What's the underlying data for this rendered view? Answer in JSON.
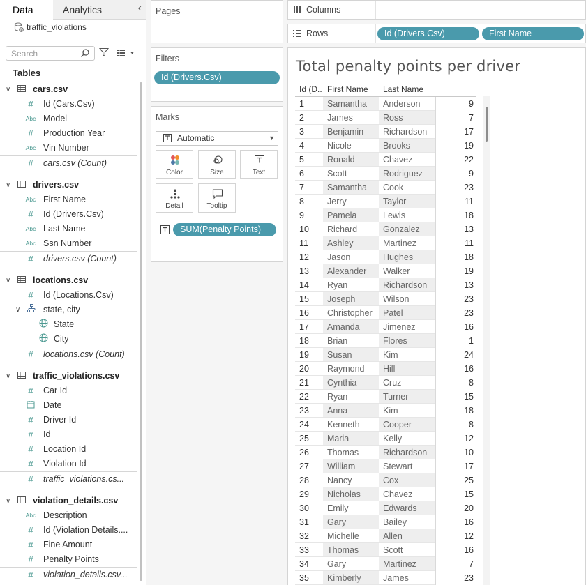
{
  "pane_tabs": {
    "data": "Data",
    "analytics": "Analytics"
  },
  "datasource": "traffic_violations",
  "search": {
    "placeholder": "Search",
    "value": ""
  },
  "tables_heading": "Tables",
  "tables": [
    {
      "name": "cars.csv",
      "fields": [
        {
          "type": "number",
          "label": "Id (Cars.Csv)"
        },
        {
          "type": "string",
          "label": "Model"
        },
        {
          "type": "number",
          "label": "Production Year"
        },
        {
          "type": "string",
          "label": "Vin Number"
        },
        {
          "type": "count",
          "label": "cars.csv (Count)"
        }
      ]
    },
    {
      "name": "drivers.csv",
      "fields": [
        {
          "type": "string",
          "label": "First Name"
        },
        {
          "type": "number",
          "label": "Id (Drivers.Csv)"
        },
        {
          "type": "string",
          "label": "Last Name"
        },
        {
          "type": "string",
          "label": "Ssn Number"
        },
        {
          "type": "count",
          "label": "drivers.csv (Count)"
        }
      ]
    },
    {
      "name": "locations.csv",
      "fields": [
        {
          "type": "number",
          "label": "Id (Locations.Csv)"
        },
        {
          "type": "hierarchy",
          "label": "state, city"
        },
        {
          "type": "geo",
          "label": "State"
        },
        {
          "type": "geo",
          "label": "City"
        },
        {
          "type": "count",
          "label": "locations.csv (Count)"
        }
      ]
    },
    {
      "name": "traffic_violations.csv",
      "fields": [
        {
          "type": "number",
          "label": "Car Id"
        },
        {
          "type": "date",
          "label": "Date"
        },
        {
          "type": "number",
          "label": "Driver Id"
        },
        {
          "type": "number",
          "label": "Id"
        },
        {
          "type": "number",
          "label": "Location Id"
        },
        {
          "type": "number",
          "label": "Violation Id"
        },
        {
          "type": "count",
          "label": "traffic_violations.cs..."
        }
      ]
    },
    {
      "name": "violation_details.csv",
      "fields": [
        {
          "type": "string",
          "label": "Description"
        },
        {
          "type": "number",
          "label": "Id (Violation Details...."
        },
        {
          "type": "number",
          "label": "Fine Amount"
        },
        {
          "type": "number",
          "label": "Penalty Points"
        },
        {
          "type": "count",
          "label": "violation_details.csv..."
        }
      ]
    }
  ],
  "cards": {
    "pages": "Pages",
    "filters": "Filters",
    "marks": "Marks"
  },
  "filter_pill": "Id (Drivers.Csv)",
  "marks": {
    "type": "Automatic",
    "buttons": {
      "color": "Color",
      "size": "Size",
      "text": "Text",
      "detail": "Detail",
      "tooltip": "Tooltip"
    },
    "pill": "SUM(Penalty Points)"
  },
  "shelves": {
    "columns": "Columns",
    "rows": "Rows",
    "rows_pills": [
      "Id (Drivers.Csv)",
      "First Name"
    ]
  },
  "view": {
    "title": "Total penalty points per driver",
    "headers": {
      "id": "Id (D..",
      "first": "First Name",
      "last": "Last Name"
    },
    "rows": [
      [
        "1",
        "Samantha",
        "Anderson",
        "9"
      ],
      [
        "2",
        "James",
        "Ross",
        "7"
      ],
      [
        "3",
        "Benjamin",
        "Richardson",
        "17"
      ],
      [
        "4",
        "Nicole",
        "Brooks",
        "19"
      ],
      [
        "5",
        "Ronald",
        "Chavez",
        "22"
      ],
      [
        "6",
        "Scott",
        "Rodriguez",
        "9"
      ],
      [
        "7",
        "Samantha",
        "Cook",
        "23"
      ],
      [
        "8",
        "Jerry",
        "Taylor",
        "11"
      ],
      [
        "9",
        "Pamela",
        "Lewis",
        "18"
      ],
      [
        "10",
        "Richard",
        "Gonzalez",
        "13"
      ],
      [
        "11",
        "Ashley",
        "Martinez",
        "11"
      ],
      [
        "12",
        "Jason",
        "Hughes",
        "18"
      ],
      [
        "13",
        "Alexander",
        "Walker",
        "19"
      ],
      [
        "14",
        "Ryan",
        "Richardson",
        "13"
      ],
      [
        "15",
        "Joseph",
        "Wilson",
        "23"
      ],
      [
        "16",
        "Christopher",
        "Patel",
        "23"
      ],
      [
        "17",
        "Amanda",
        "Jimenez",
        "16"
      ],
      [
        "18",
        "Brian",
        "Flores",
        "1"
      ],
      [
        "19",
        "Susan",
        "Kim",
        "24"
      ],
      [
        "20",
        "Raymond",
        "Hill",
        "16"
      ],
      [
        "21",
        "Cynthia",
        "Cruz",
        "8"
      ],
      [
        "22",
        "Ryan",
        "Turner",
        "15"
      ],
      [
        "23",
        "Anna",
        "Kim",
        "18"
      ],
      [
        "24",
        "Kenneth",
        "Cooper",
        "8"
      ],
      [
        "25",
        "Maria",
        "Kelly",
        "12"
      ],
      [
        "26",
        "Thomas",
        "Richardson",
        "10"
      ],
      [
        "27",
        "William",
        "Stewart",
        "17"
      ],
      [
        "28",
        "Nancy",
        "Cox",
        "25"
      ],
      [
        "29",
        "Nicholas",
        "Chavez",
        "15"
      ],
      [
        "30",
        "Emily",
        "Edwards",
        "20"
      ],
      [
        "31",
        "Gary",
        "Bailey",
        "16"
      ],
      [
        "32",
        "Michelle",
        "Allen",
        "12"
      ],
      [
        "33",
        "Thomas",
        "Scott",
        "16"
      ],
      [
        "34",
        "Gary",
        "Martinez",
        "7"
      ],
      [
        "35",
        "Kimberly",
        "James",
        "23"
      ]
    ]
  },
  "colors": {
    "pill": "#4a9aac",
    "field_icon": "#4d9a92",
    "band": "#eeeeee"
  }
}
